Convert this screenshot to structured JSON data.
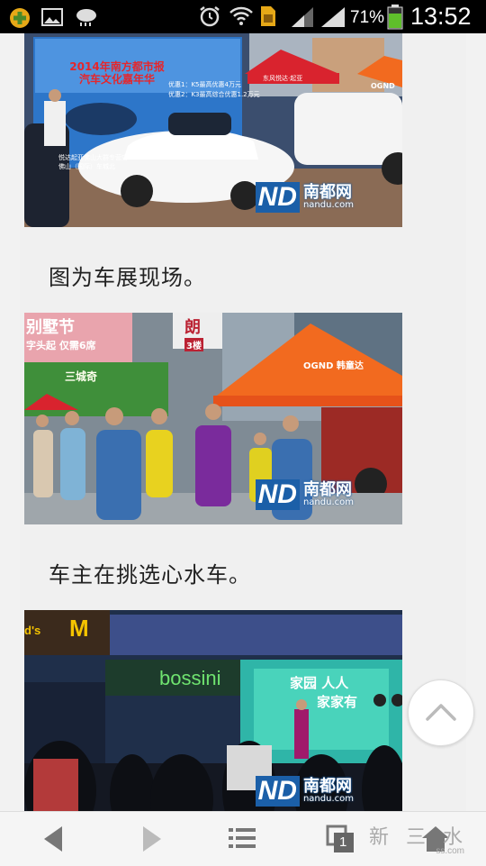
{
  "status_bar": {
    "battery_percent": "71%",
    "time": "13:52",
    "icons": [
      "app-badge-icon",
      "image-icon",
      "cloud-rain-icon",
      "alarm-icon",
      "wifi-icon",
      "sim-card-icon",
      "signal-icon",
      "signal-icon",
      "battery-icon"
    ]
  },
  "article": {
    "photo1": {
      "banner_title_line1": "2014年南方都市报",
      "banner_title_line2": "汽车文化嘉年华",
      "banner_offer1": "优惠1：K5最高优惠4万元",
      "banner_offer2": "优惠2：K3最高综合优惠1.2万元",
      "banner_bottom": "悦达起亚佛山大群专营店",
      "banner_bottom2": "佛山（国际）车城北",
      "tent_text": "东风悦达·起亚",
      "tent_text2": "OGND",
      "watermark_logo": "ND",
      "watermark_cn": "南都网",
      "watermark_url": "nandu.com"
    },
    "caption1": "图为车展现场。",
    "photo2": {
      "sign_left": "别墅节",
      "sign_left_sub": "字头起 仅需6席",
      "sign_mid": "朗",
      "sign_mid_sub": "3楼",
      "sign_green": "三城奇",
      "tent_text": "OGND 韩童达",
      "watermark_logo": "ND",
      "watermark_cn": "南都网",
      "watermark_url": "nandu.com"
    },
    "caption2": "车主在挑选心水车。",
    "photo3": {
      "sign_mcd": "M",
      "sign_left": "d's",
      "sign_bossini": "bossini",
      "sign_stage": "家园 人人",
      "sign_stage2": "家家有",
      "watermark_logo": "ND",
      "watermark_cn": "南都网",
      "watermark_url": "nandu.com"
    }
  },
  "scroll_top_button": {
    "icon": "chevron-up-icon"
  },
  "bottom_bar": {
    "back": "back-arrow-icon",
    "forward": "forward-arrow-icon",
    "menu": "list-menu-icon",
    "tabs_count": "1",
    "home": "home-icon",
    "corner_mark": "新 三 水",
    "corner_url": "ss.com"
  },
  "colors": {
    "status_bar": "#000000",
    "page_bg": "#f2f2f2",
    "watermark_blue": "#1b5fa8",
    "tent_red": "#d9232e",
    "tent_orange": "#f26a1f"
  }
}
